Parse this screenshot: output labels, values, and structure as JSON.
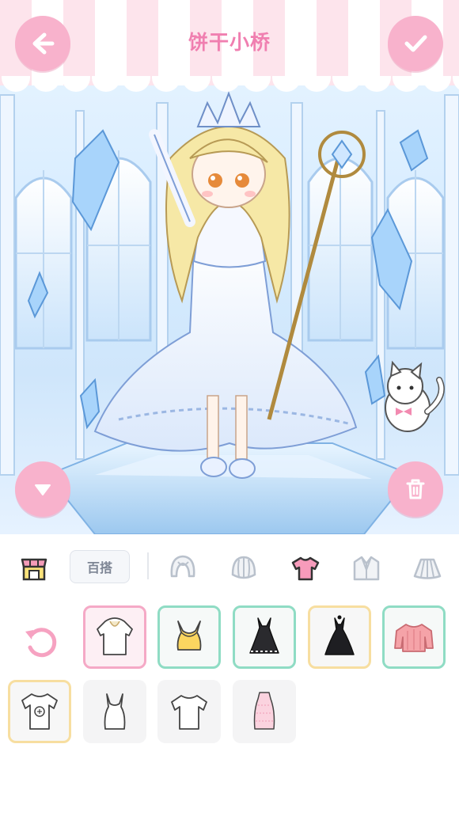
{
  "header": {
    "title": "饼干小桥",
    "back_icon": "arrow-left-icon",
    "confirm_icon": "check-icon"
  },
  "scene": {
    "description_icons": [
      "crystal-icon",
      "cat-icon"
    ]
  },
  "side_buttons": {
    "collapse_icon": "triangle-down-icon",
    "trash_icon": "trash-icon"
  },
  "toolbar": {
    "shop_icon": "shop-icon",
    "baida_label": "百搭",
    "categories": [
      {
        "id": "hair",
        "icon": "hair-icon",
        "active": false
      },
      {
        "id": "hat",
        "icon": "bonnet-icon",
        "active": false
      },
      {
        "id": "tops",
        "icon": "tshirt-icon",
        "active": true
      },
      {
        "id": "jacket",
        "icon": "jacket-icon",
        "active": false
      },
      {
        "id": "skirt",
        "icon": "skirt-icon",
        "active": false
      }
    ]
  },
  "items": [
    {
      "name": "white-hooded-top",
      "state": "selected"
    },
    {
      "name": "yellow-camisole",
      "state": "new"
    },
    {
      "name": "black-lace-dress",
      "state": "new"
    },
    {
      "name": "black-tulle-dress",
      "state": "owned"
    },
    {
      "name": "pink-knit-sweater",
      "state": "new"
    },
    {
      "name": "printed-tshirt",
      "state": "owned"
    },
    {
      "name": "white-tank-top",
      "state": "plain"
    },
    {
      "name": "white-tshirt",
      "state": "plain"
    },
    {
      "name": "pink-lace-top",
      "state": "plain"
    }
  ],
  "colors": {
    "accent_pink": "#f8b2cc",
    "title_pink": "#f07fb0",
    "border_green": "#8fdcc4",
    "border_yellow": "#f7dea0"
  }
}
